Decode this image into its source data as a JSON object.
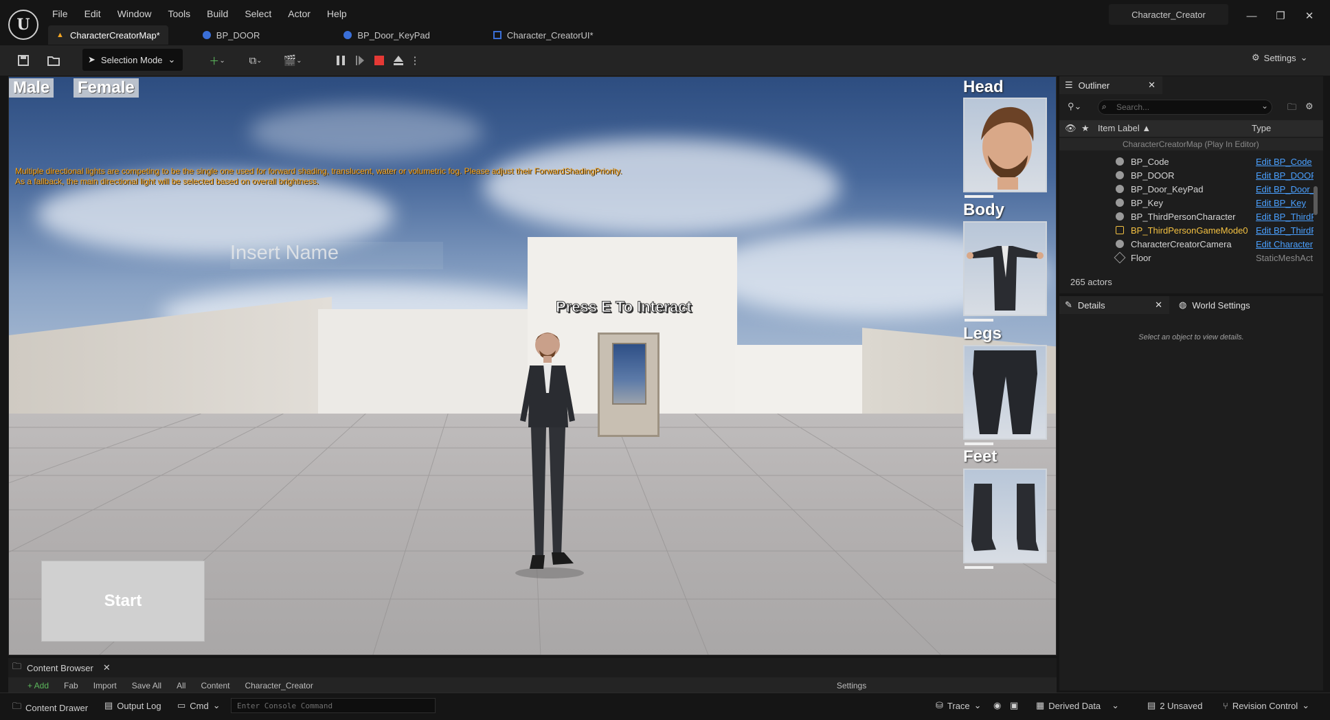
{
  "app": {
    "logo_label": "U",
    "menu": [
      "File",
      "Edit",
      "Window",
      "Tools",
      "Build",
      "Select",
      "Actor",
      "Help"
    ],
    "project_name": "Character_Creator",
    "window_buttons": [
      "—",
      "❐",
      "✕"
    ]
  },
  "tabs": [
    {
      "label": "CharacterCreatorMap*",
      "icon": "level-icon",
      "active": true
    },
    {
      "label": "BP_DOOR",
      "icon": "blueprint-icon",
      "active": false
    },
    {
      "label": "BP_Door_KeyPad",
      "icon": "blueprint-icon",
      "active": false
    },
    {
      "label": "Character_CreatorUI*",
      "icon": "widget-blueprint-icon",
      "active": false
    }
  ],
  "toolbar": {
    "selection_mode": "Selection Mode",
    "settings": "Settings"
  },
  "viewport": {
    "warning_line1": "Multiple directional lights are competing to be the single one used for forward shading, translucent, water or volumetric fog. Please adjust their ForwardShadingPriority.",
    "warning_line2": "As a fallback, the main directional light will be selected based on overall brightness.",
    "male": "Male",
    "female": "Female",
    "insert_name": "Insert Name",
    "press_e": "Press E To Interact",
    "start": "Start",
    "parts": [
      "Head",
      "Body",
      "Legs",
      "Feet"
    ]
  },
  "content_browser": {
    "tab": "Content Browser",
    "tools": [
      "+ Add",
      "Fab",
      "Import",
      "Save All",
      "All",
      "Content",
      "Character_Creator",
      "Settings"
    ]
  },
  "statusbar": {
    "content_drawer": "Content Drawer",
    "output_log": "Output Log",
    "cmd": "Cmd",
    "console_placeholder": "Enter Console Command",
    "trace": "Trace",
    "derived_data": "Derived Data",
    "unsaved": "2 Unsaved",
    "revision_control": "Revision Control"
  },
  "outliner": {
    "tab": "Outliner",
    "search_placeholder": "Search...",
    "col_label": "Item Label ▲",
    "col_type": "Type",
    "map_row": "CharacterCreatorMap (Play In Editor)",
    "rows": [
      {
        "name": "BP_Code",
        "type": "Edit BP_Code"
      },
      {
        "name": "BP_DOOR",
        "type": "Edit BP_DOOR"
      },
      {
        "name": "BP_Door_KeyPad",
        "type": "Edit BP_Door_"
      },
      {
        "name": "BP_Key",
        "type": "Edit BP_Key"
      },
      {
        "name": "BP_ThirdPersonCharacter",
        "type": "Edit BP_ThirdP"
      },
      {
        "name": "BP_ThirdPersonGameMode0",
        "type": "Edit BP_ThirdP"
      },
      {
        "name": "CharacterCreatorCamera",
        "type": "Edit Character"
      },
      {
        "name": "Floor",
        "type": "StaticMeshAct"
      }
    ],
    "count": "265 actors"
  },
  "details": {
    "tab": "Details",
    "world_settings": "World Settings",
    "empty_message": "Select an object to view details."
  },
  "colors": {
    "accent_warning": "#f5a623",
    "link": "#4aa0ff",
    "stop_button": "#e53935"
  }
}
